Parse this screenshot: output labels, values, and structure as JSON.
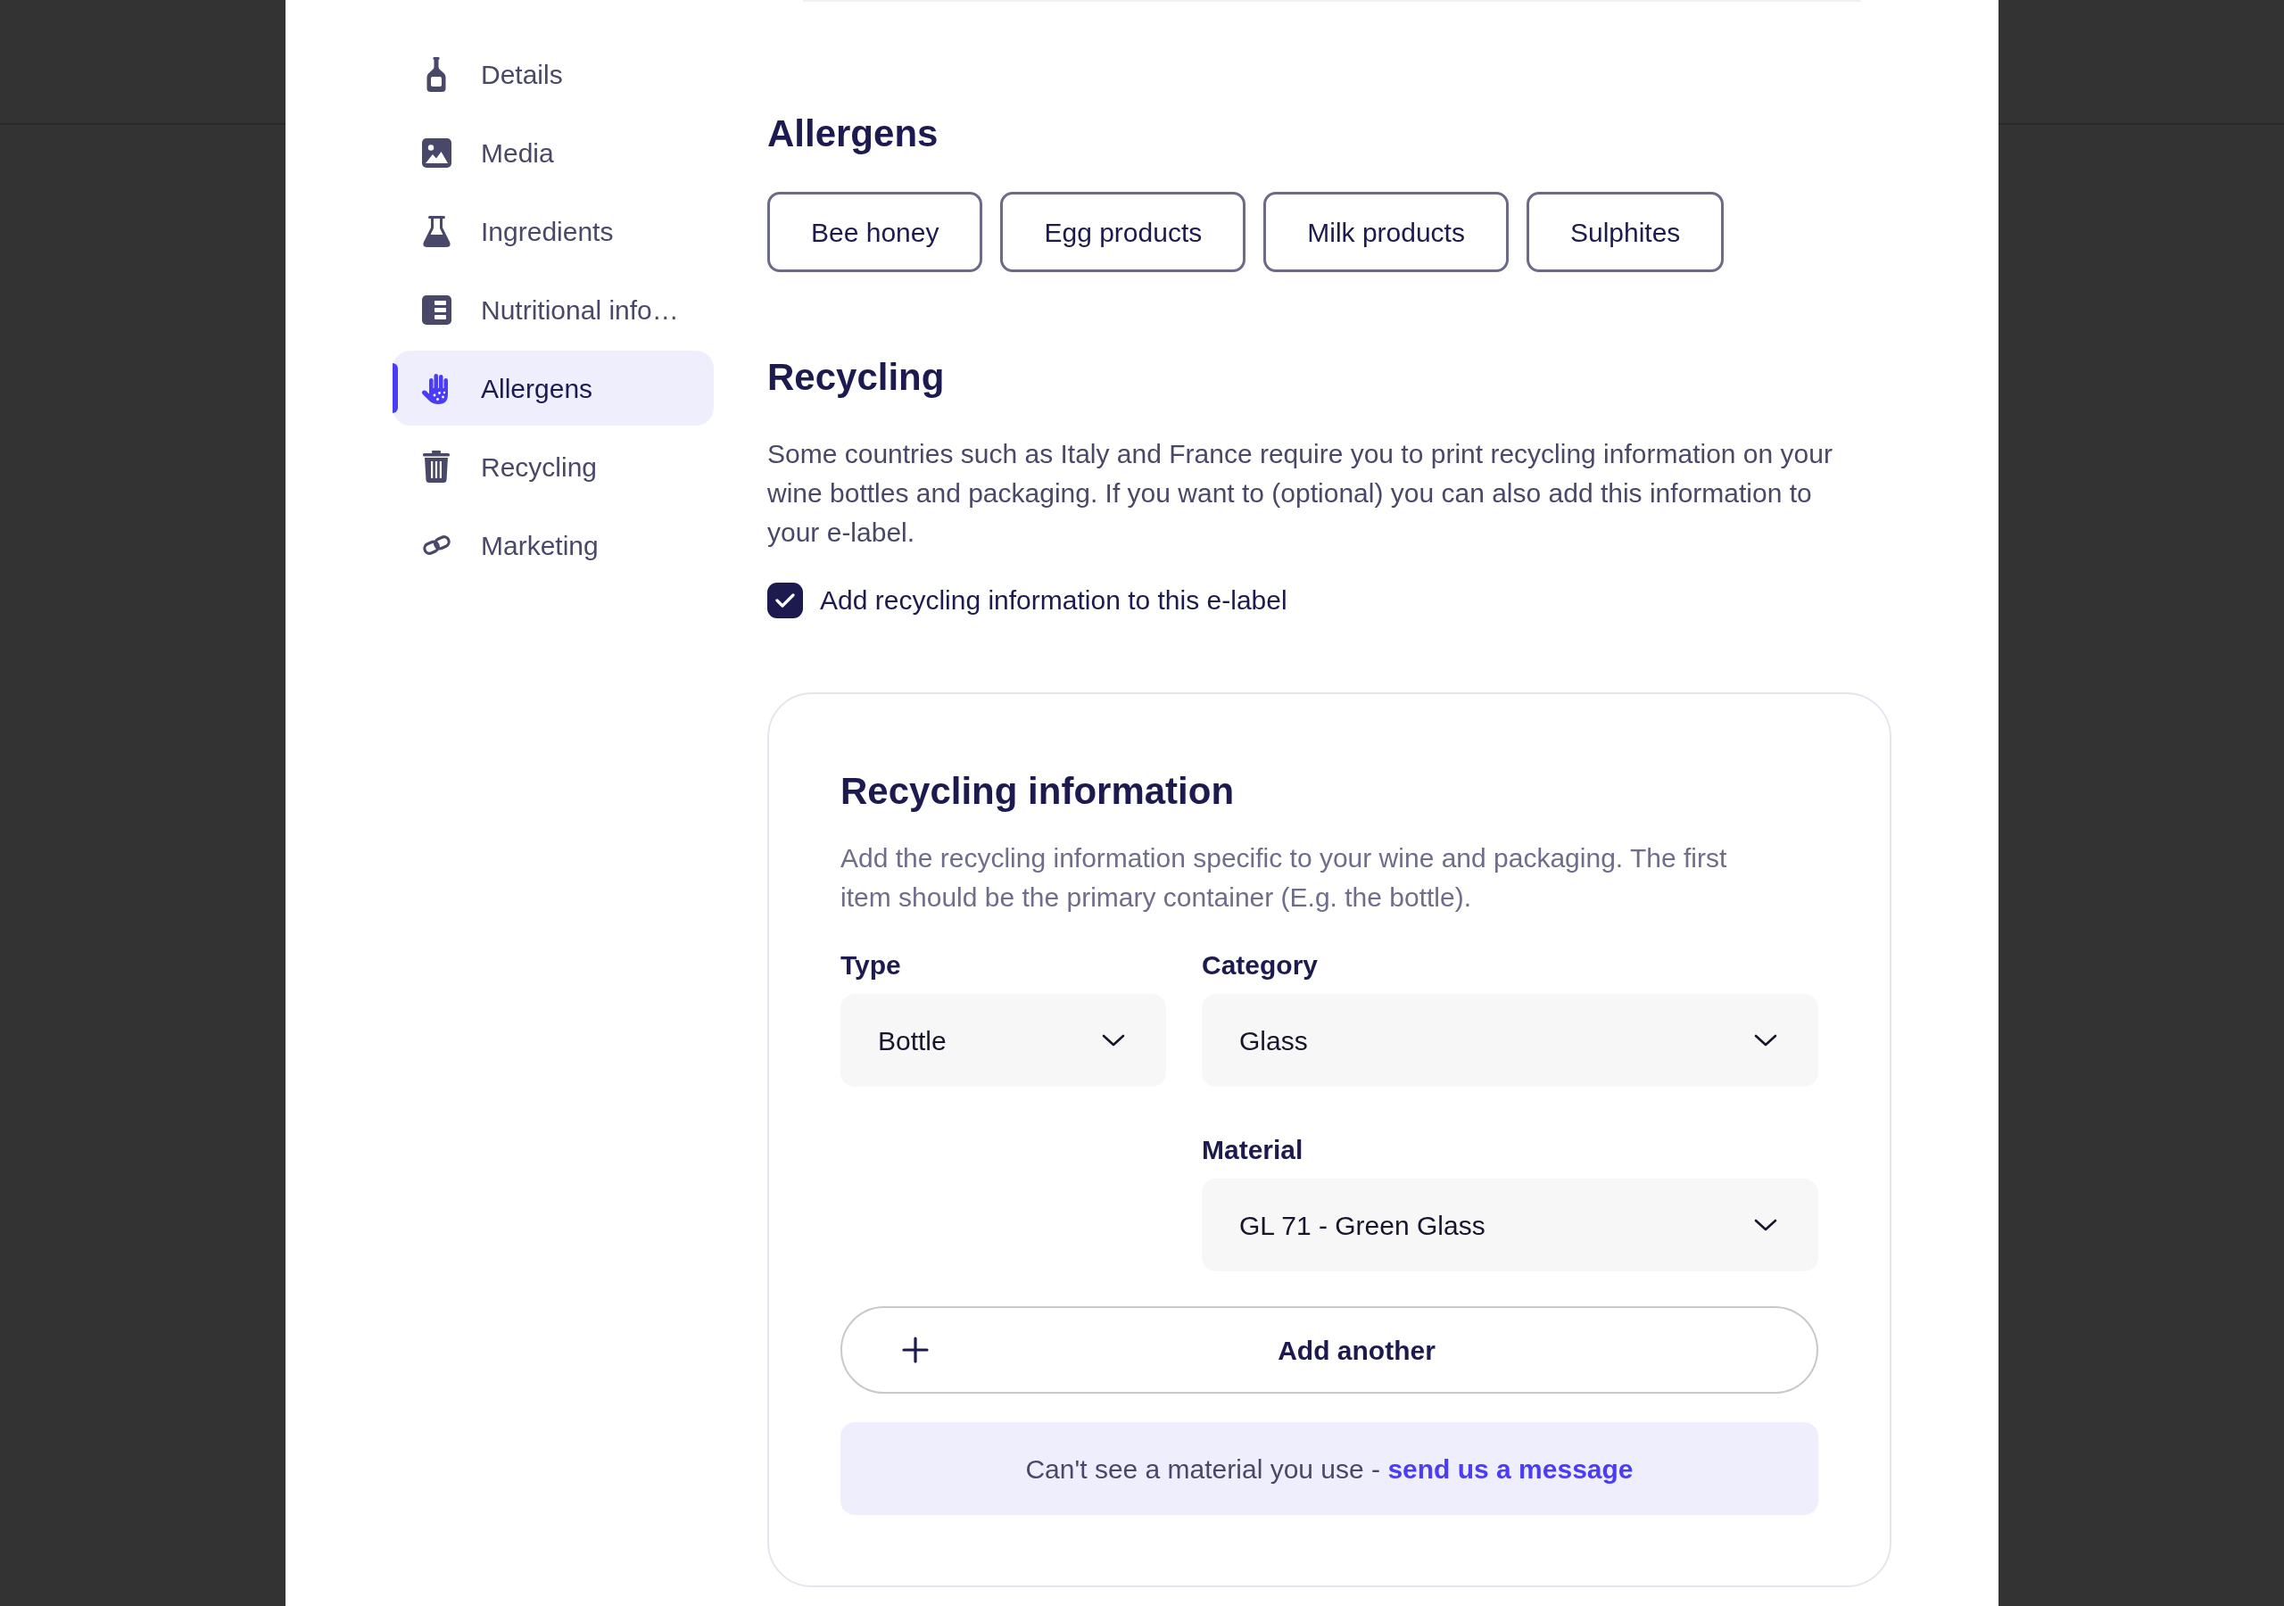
{
  "sidebar": {
    "items": [
      {
        "label": "Details",
        "selected": false
      },
      {
        "label": "Media",
        "selected": false
      },
      {
        "label": "Ingredients",
        "selected": false
      },
      {
        "label": "Nutritional info…",
        "selected": false
      },
      {
        "label": "Allergens",
        "selected": true
      },
      {
        "label": "Recycling",
        "selected": false
      },
      {
        "label": "Marketing",
        "selected": false
      }
    ]
  },
  "allergens": {
    "title": "Allergens",
    "tags": [
      "Bee honey",
      "Egg products",
      "Milk products",
      "Sulphites"
    ]
  },
  "recycling": {
    "title": "Recycling",
    "description": "Some countries such as Italy and France require you to print recycling information on your wine bottles and packaging. If you want to (optional) you can also add this information to your e-label.",
    "checkbox": {
      "label": "Add recycling information to this e-label",
      "checked": true
    },
    "info_card": {
      "title": "Recycling information",
      "description": "Add the recycling information specific to your wine and packaging. The first item should be the primary container (E.g. the bottle).",
      "fields": [
        {
          "label": "Type",
          "value": "Bottle"
        },
        {
          "label": "Category",
          "value": "Glass"
        },
        {
          "label": "Material",
          "value": "GL 71 - Green Glass"
        }
      ],
      "add_button": "Add another",
      "notice": {
        "text": "Can't see a material you use - ",
        "link": "send us a message"
      }
    }
  }
}
